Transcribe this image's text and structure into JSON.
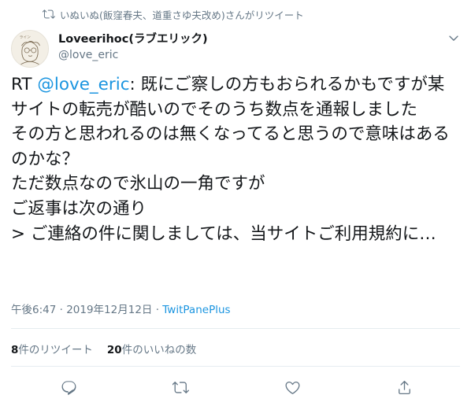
{
  "retweet_header": {
    "text": "いぬいぬ(飯窪春夫、道重さゆ夫改め)さんがリツイート",
    "icon": "retweet-icon"
  },
  "author": {
    "display_name": "Loveerihoc(ラブエリック)",
    "handle": "@love_eric",
    "avatar_icon": "avatar-sketch"
  },
  "tweet": {
    "prefix": "RT ",
    "mention": "@love_eric",
    "body": ": 既にご察しの方もおられるかもですが某サイトの転売が酷いのでそのうち数点を通報しました\nその方と思われるのは無くなってると思うので意味はあるのかな？\nただ数点なので氷山の一角ですが\nご返事は次の通り\n> ご連絡の件に関しましては、当サイトご利用規約に…"
  },
  "meta": {
    "time": "午後6:47",
    "separator": " · ",
    "date": "2019年12月12日",
    "source": "TwitPanePlus"
  },
  "stats": {
    "retweet_count": "8",
    "retweet_label": "件のリツイート",
    "like_count": "20",
    "like_label": "件のいいねの数"
  },
  "actions": [
    "reply-icon",
    "retweet-icon",
    "like-icon",
    "share-icon"
  ],
  "colors": {
    "link": "#1b95e0",
    "muted": "#657786",
    "text": "#14171a",
    "divider": "#e6ecf0"
  }
}
